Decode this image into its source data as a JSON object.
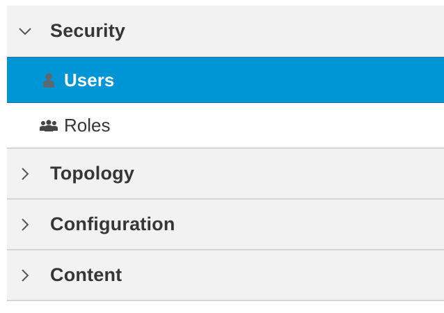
{
  "nav": {
    "sections": [
      {
        "title": "Security",
        "expanded": true,
        "items": [
          {
            "label": "Users",
            "icon": "user-icon",
            "active": true
          },
          {
            "label": "Roles",
            "icon": "users-group-icon",
            "active": false
          }
        ]
      },
      {
        "title": "Topology",
        "expanded": false
      },
      {
        "title": "Configuration",
        "expanded": false
      },
      {
        "title": "Content",
        "expanded": false
      }
    ]
  },
  "colors": {
    "active_bg": "#0096d6",
    "header_bg": "#f2f2f2",
    "text": "#363636"
  }
}
